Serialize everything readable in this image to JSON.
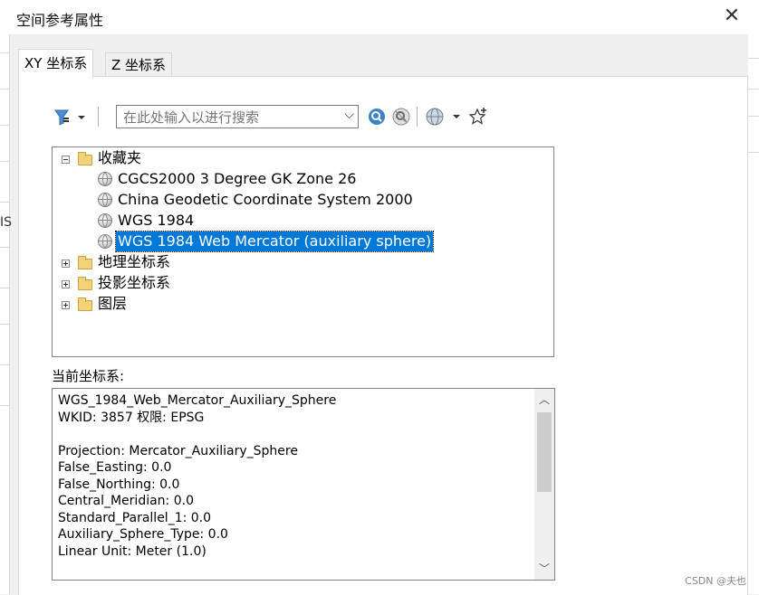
{
  "window": {
    "title": "空间参考属性",
    "close_glyph": "✕"
  },
  "background": {
    "partial_text": "IS"
  },
  "tabs": [
    {
      "label": "XY 坐标系",
      "active": true
    },
    {
      "label": "Z 坐标系",
      "active": false
    }
  ],
  "toolbar": {
    "filter_icon": "filter-icon",
    "search": {
      "placeholder": "在此处输入以进行搜索",
      "value": ""
    },
    "search_button_icon": "magnifier-icon",
    "clear_search_icon": "clear-search-icon",
    "globe_menu_icon": "globe-icon",
    "add_favorite_icon": "star-add-icon"
  },
  "tree": {
    "favorites": {
      "label": "收藏夹",
      "items": [
        "CGCS2000 3 Degree GK Zone 26",
        "China Geodetic Coordinate System 2000",
        "WGS 1984",
        "WGS 1984 Web Mercator (auxiliary sphere)"
      ],
      "selected_index": 3
    },
    "folders": [
      "地理坐标系",
      "投影坐标系",
      "图层"
    ]
  },
  "current": {
    "label": "当前坐标系:",
    "lines": [
      "WGS_1984_Web_Mercator_Auxiliary_Sphere",
      "WKID: 3857 权限: EPSG",
      "",
      "Projection: Mercator_Auxiliary_Sphere",
      "False_Easting: 0.0",
      "False_Northing: 0.0",
      "Central_Meridian: 0.0",
      "Standard_Parallel_1: 0.0",
      "Auxiliary_Sphere_Type: 0.0",
      "Linear Unit: Meter (1.0)"
    ]
  },
  "colors": {
    "selection": "#0078d7",
    "folder": "#f2d27b"
  },
  "watermark": "CSDN @夫也"
}
